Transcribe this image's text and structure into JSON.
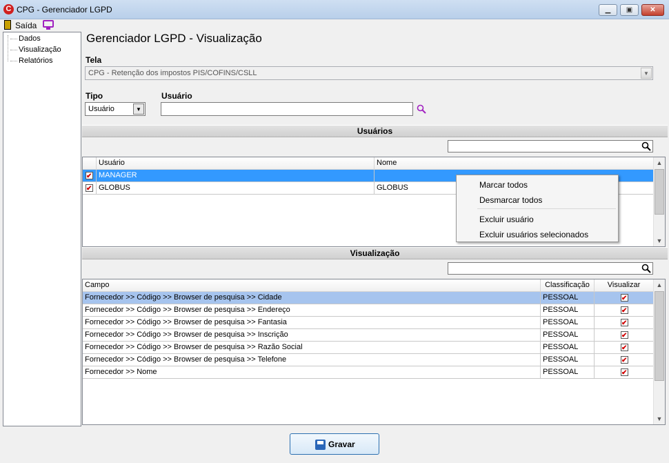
{
  "window": {
    "title": "CPG - Gerenciador LGPD",
    "minimize": "▁",
    "restore": "▣",
    "close": "✕"
  },
  "menu": {
    "exit_label": "Saída"
  },
  "tree": {
    "items": [
      "Dados",
      "Visualização",
      "Relatórios"
    ]
  },
  "page": {
    "title": "Gerenciador LGPD - Visualização"
  },
  "form": {
    "tela_label": "Tela",
    "tela_value": "CPG - Retenção dos impostos PIS/COFINS/CSLL",
    "tipo_label": "Tipo",
    "tipo_value": "Usuário",
    "usuario_label": "Usuário",
    "usuario_value": ""
  },
  "users_section": {
    "title": "Usuários",
    "search_value": "",
    "columns": [
      "Usuário",
      "Nome"
    ],
    "rows": [
      {
        "usuario": "MANAGER",
        "nome": "",
        "checked": true,
        "selected": true
      },
      {
        "usuario": "GLOBUS",
        "nome": "GLOBUS",
        "checked": true,
        "selected": false
      }
    ]
  },
  "context_menu": {
    "items": [
      "Marcar todos",
      "Desmarcar todos",
      "Excluir usuário",
      "Excluir usuários selecionados"
    ]
  },
  "view_section": {
    "title": "Visualização",
    "search_value": "",
    "columns": [
      "Campo",
      "Classificação",
      "Visualizar"
    ],
    "rows": [
      {
        "campo": "Fornecedor >> Código >> Browser de pesquisa >> Cidade",
        "classificacao": "PESSOAL",
        "visualizar": true
      },
      {
        "campo": "Fornecedor >> Código >> Browser de pesquisa >> Endereço",
        "classificacao": "PESSOAL",
        "visualizar": true
      },
      {
        "campo": "Fornecedor >> Código >> Browser de pesquisa >> Fantasia",
        "classificacao": "PESSOAL",
        "visualizar": true
      },
      {
        "campo": "Fornecedor >> Código >> Browser de pesquisa >> Inscrição",
        "classificacao": "PESSOAL",
        "visualizar": true
      },
      {
        "campo": "Fornecedor >> Código >> Browser de pesquisa >> Razão Social",
        "classificacao": "PESSOAL",
        "visualizar": true
      },
      {
        "campo": "Fornecedor >> Código >> Browser de pesquisa >> Telefone",
        "classificacao": "PESSOAL",
        "visualizar": true
      },
      {
        "campo": "Fornecedor >> Nome",
        "classificacao": "PESSOAL",
        "visualizar": true
      }
    ]
  },
  "footer": {
    "save_label": "Gravar"
  },
  "colors": {
    "selection": "#3399ff",
    "accent_purple": "#a020c0",
    "check_red": "#d00000"
  },
  "icons": [
    "app-logo-icon",
    "exit-door-icon",
    "monitor-icon",
    "search-icon",
    "save-disk-icon",
    "chevron-down-icon"
  ]
}
